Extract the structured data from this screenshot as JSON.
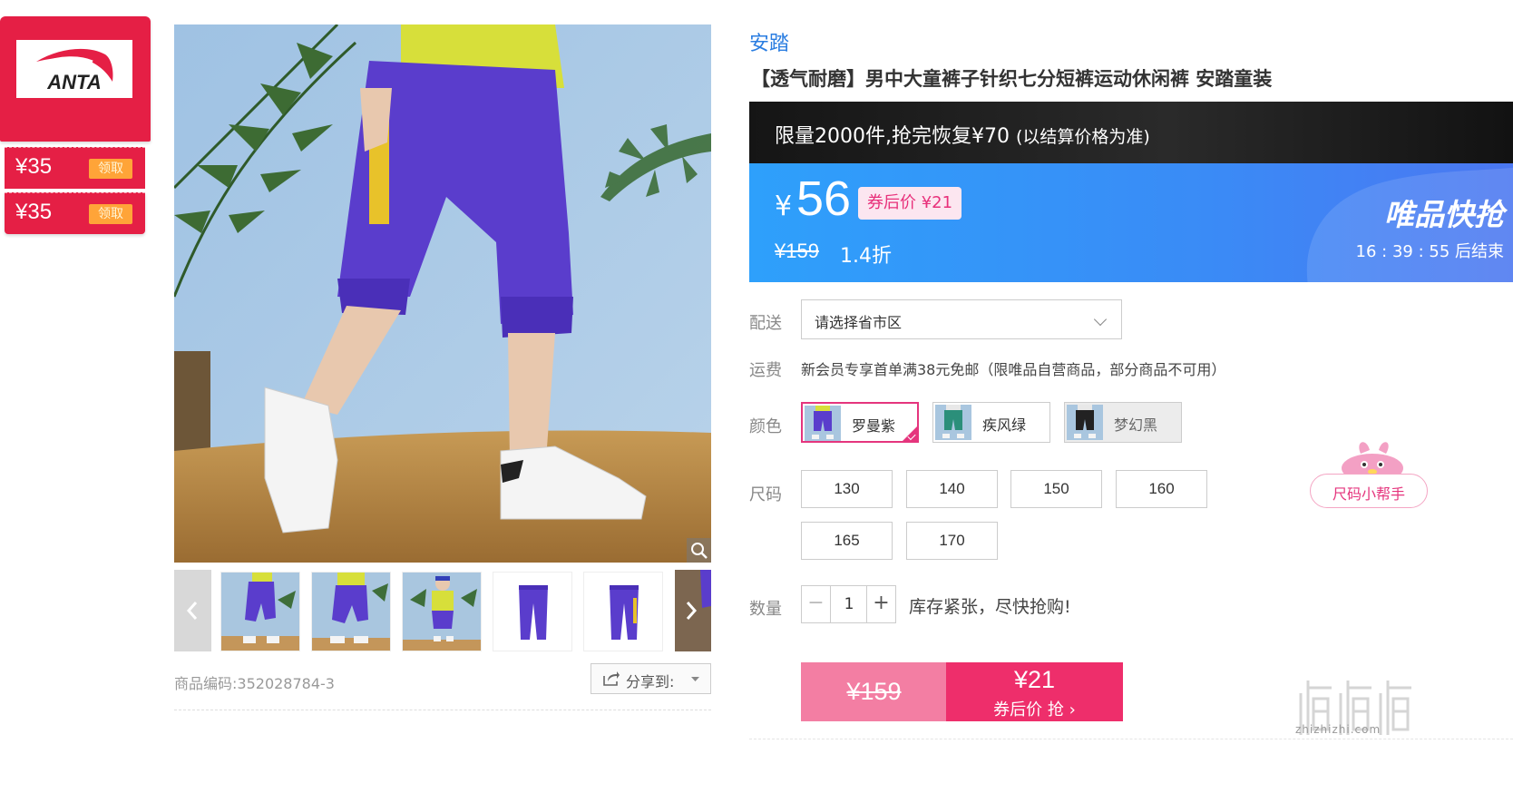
{
  "coupon_panel": {
    "logo_text": "ANTA",
    "coupons": [
      {
        "amount": "¥35",
        "claim_label": "领取"
      },
      {
        "amount": "¥35",
        "claim_label": "领取"
      }
    ]
  },
  "gallery": {
    "thumbnails_count_visible": 5
  },
  "sku": {
    "label": "商品编码:",
    "value": "352028784-3"
  },
  "share": {
    "label": "分享到:"
  },
  "product": {
    "brand": "安踏",
    "title": "【透气耐磨】男中大童裤子针织七分短裤运动休闲裤 安踏童装"
  },
  "promo": {
    "main_text": "限量2000件,抢完恢复¥70",
    "note": "(以结算价格为准)"
  },
  "price": {
    "currency": "¥",
    "current": "56",
    "after_coupon": "券后价 ¥21",
    "original": "¥159",
    "discount": "1.4折",
    "flash_label": "唯品快抢",
    "countdown": "16 : 39 : 55  后结束"
  },
  "delivery": {
    "label": "配送",
    "placeholder": "请选择省市区"
  },
  "shipping": {
    "label": "运费",
    "text": "新会员专享首单满38元免邮（限唯品自营商品，部分商品不可用）"
  },
  "colors": {
    "label": "颜色",
    "options": [
      {
        "name": "罗曼紫",
        "selected": true
      },
      {
        "name": "疾风绿",
        "selected": false
      },
      {
        "name": "梦幻黑",
        "selected": false
      }
    ]
  },
  "sizes": {
    "label": "尺码",
    "options": [
      "130",
      "140",
      "150",
      "160",
      "165",
      "170"
    ],
    "helper": "尺码小帮手"
  },
  "quantity": {
    "label": "数量",
    "minus": "−",
    "value": "1",
    "plus": "+",
    "stock_note": "库存紧张，尽快抢购!"
  },
  "buy": {
    "original": "¥159",
    "price": "¥21",
    "label": "券后价 抢 ›"
  },
  "watermark": {
    "text": "值",
    "site": "zhizhizhi.com"
  },
  "colors_theme": {
    "brand_red": "#e51f45",
    "accent_pink": "#ee2e6b",
    "price_blue": "#3a8bf6",
    "link_blue": "#2a7de1"
  }
}
